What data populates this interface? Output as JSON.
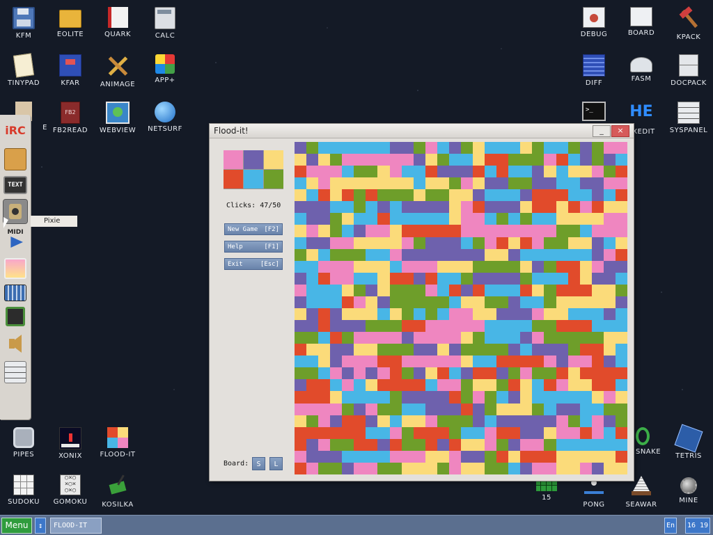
{
  "desktop_icons": {
    "kfm": "KFM",
    "eolite": "EOLITE",
    "quark": "QUARK",
    "calc": "CALC",
    "tinypad": "TINYPAD",
    "kfar": "KFAR",
    "animage": "ANIMAGE",
    "appplus": "APP+",
    "fb2read": "FB2READ",
    "webview": "WEBVIEW",
    "netsurf": "NETSURF",
    "debug": "DEBUG",
    "board": "BOARD",
    "kpack": "KPACK",
    "diff": "DIFF",
    "fasm": "FASM",
    "docpack": "DOCPACK",
    "execdit": "EXEDIT",
    "syspanel": "SYSPANEL",
    "pipes": "PIPES",
    "xonix": "XONIX",
    "floodit": "FLOOD-IT",
    "sudoku": "SUDOKU",
    "gomoku": "GOMOKU",
    "kosilka": "KOSILKA",
    "snake": "SNAKE",
    "tetris": "TETRIS",
    "fifteen": "15",
    "pong": "PONG",
    "seawar": "SEAWAR",
    "mine": "MINE",
    "partial_left": "E"
  },
  "dock": {
    "tooltip": "Pixie"
  },
  "window": {
    "title": "Flood-it!",
    "minimize_label": "_",
    "close_label": "×",
    "clicks_label": "Clicks:",
    "clicks_value": "47/50",
    "buttons": {
      "new_game": {
        "label": "New Game",
        "key": "[F2]"
      },
      "help": {
        "label": "Help",
        "key": "[F1]"
      },
      "exit": {
        "label": "Exit",
        "key": "[Esc]"
      }
    },
    "board_label": "Board:",
    "size_small": "S",
    "size_large": "L",
    "palette": [
      "#ef86c0",
      "#6e61ad",
      "#fbdb7a",
      "#e14b2b",
      "#48b6e6",
      "#6e9e2a"
    ]
  },
  "taskbar": {
    "menu": "Menu",
    "swap": "↕",
    "task": "FLOOD-IT",
    "lang": "En",
    "clock": "16 19"
  }
}
